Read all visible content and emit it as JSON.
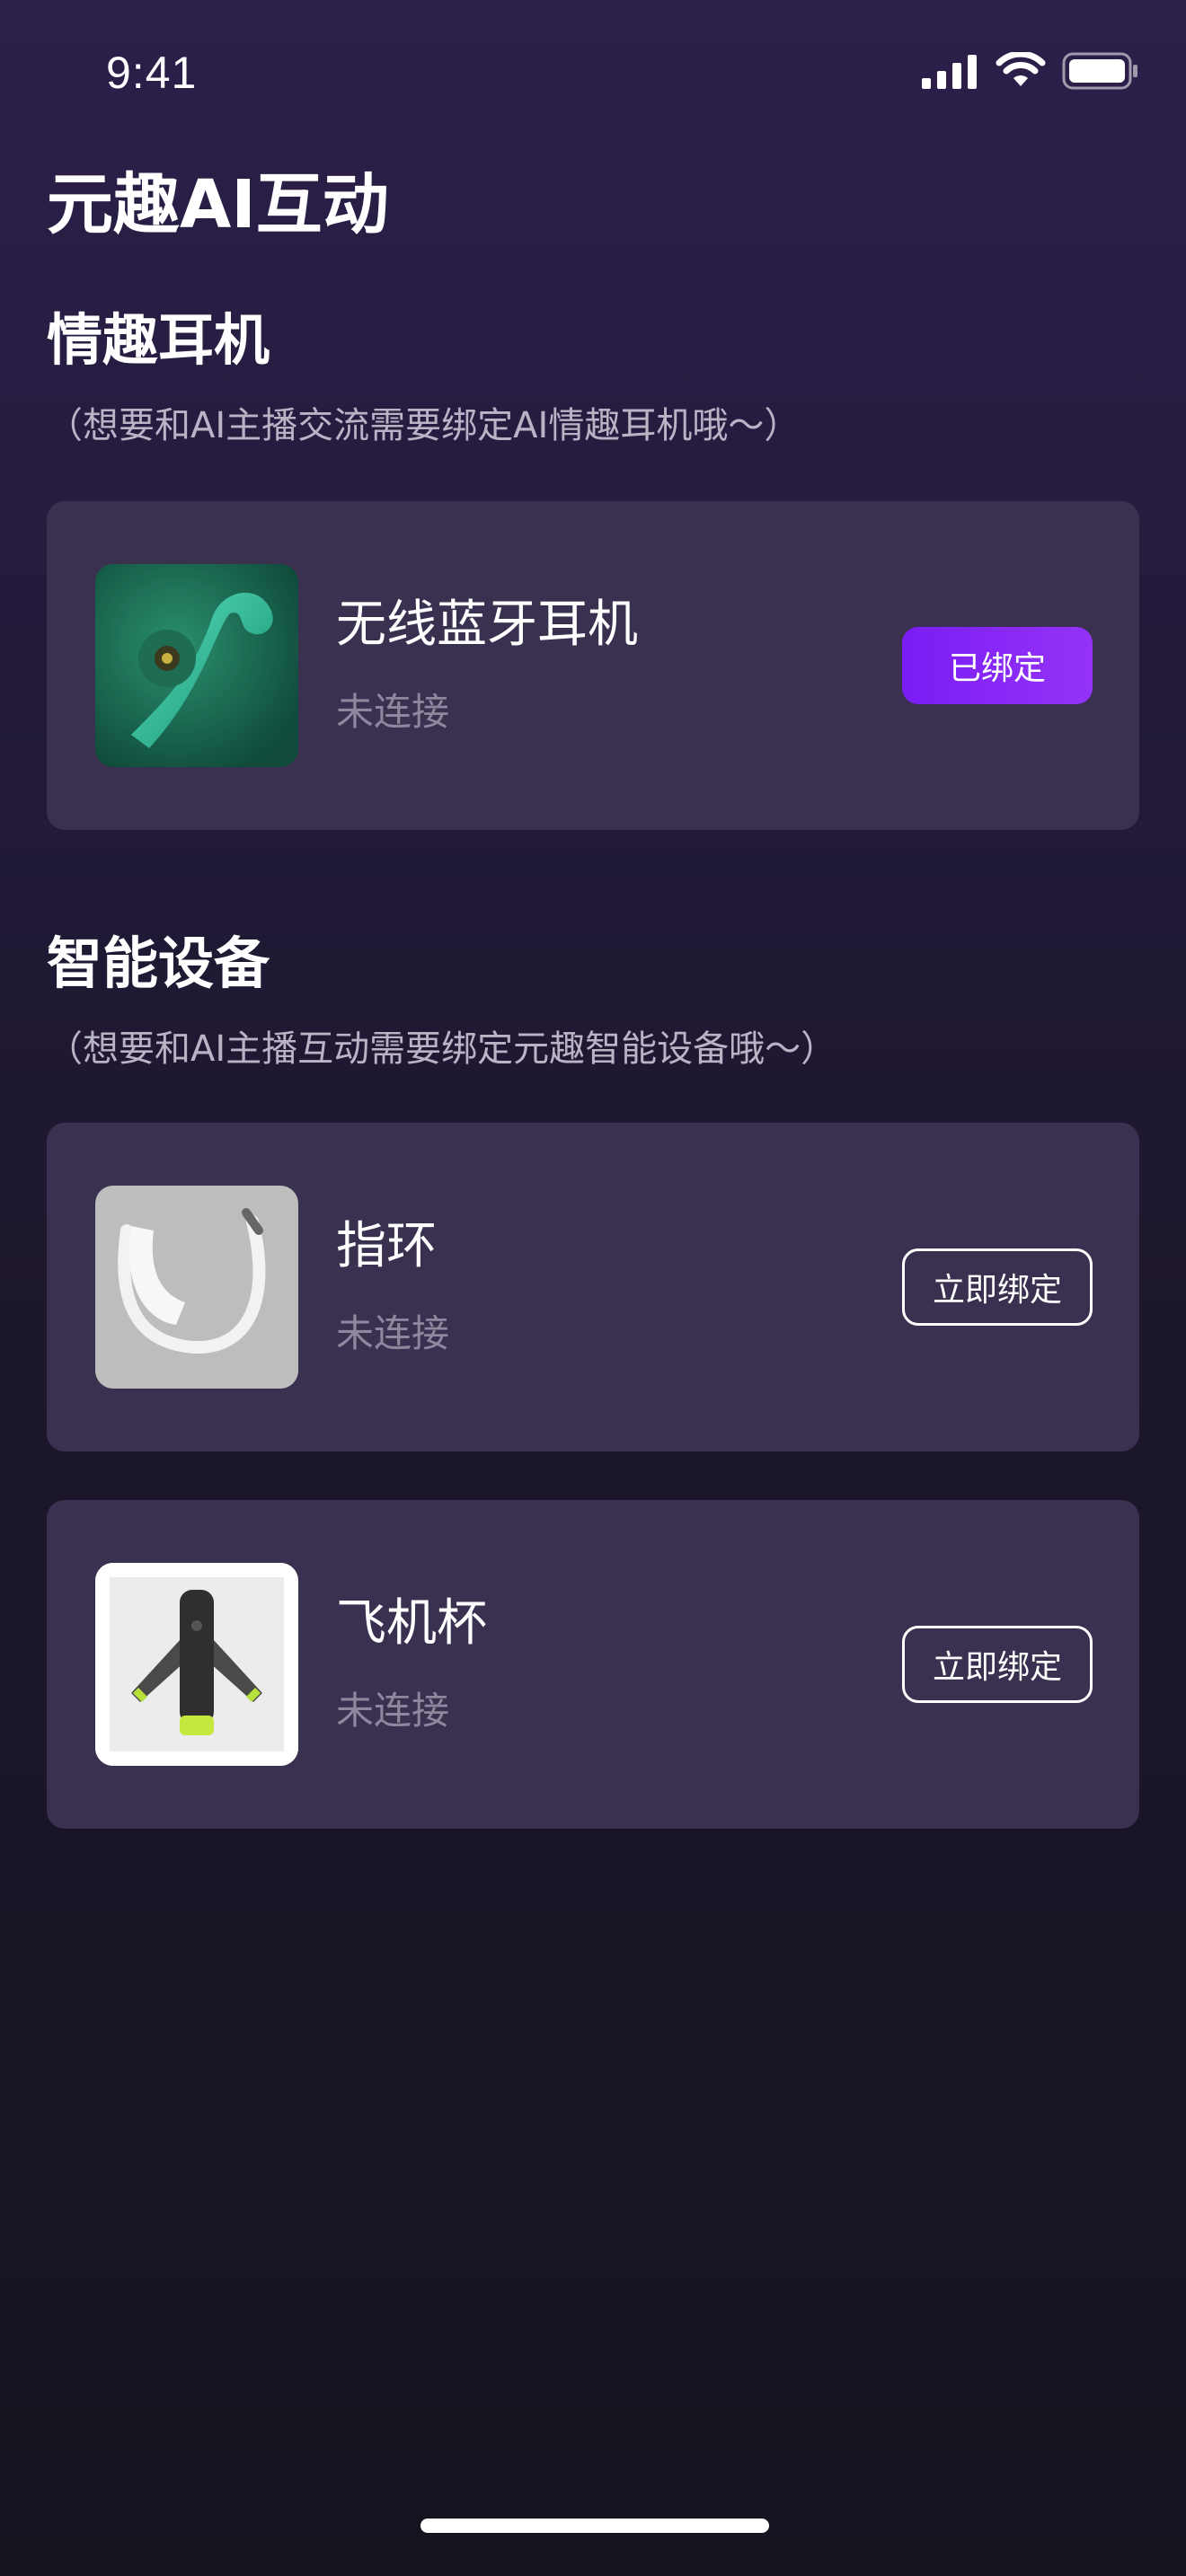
{
  "status_bar": {
    "time": "9:41",
    "icons": [
      "signal-icon",
      "wifi-icon",
      "battery-icon"
    ]
  },
  "page": {
    "title": "元趣AI互动"
  },
  "sections": [
    {
      "title": "情趣耳机",
      "hint": "（想要和AI主播交流需要绑定AI情趣耳机哦～）",
      "devices": [
        {
          "name": "无线蓝牙耳机",
          "status": "未连接",
          "button_label": "已绑定",
          "bound": true,
          "image": "bluetooth-earphone-image"
        }
      ]
    },
    {
      "title": "智能设备",
      "hint": "（想要和AI主播互动需要绑定元趣智能设备哦～）",
      "devices": [
        {
          "name": "指环",
          "status": "未连接",
          "button_label": "立即绑定",
          "bound": false,
          "image": "ring-image"
        },
        {
          "name": "飞机杯",
          "status": "未连接",
          "button_label": "立即绑定",
          "bound": false,
          "image": "cup-device-image"
        }
      ]
    }
  ],
  "colors": {
    "background_top": "#2c1f4a",
    "background_bottom": "#16131f",
    "card": "#3a3150",
    "accent_purple": "#8a2af6",
    "hint_text": "#b9b3c6",
    "status_text": "#8e879d"
  }
}
